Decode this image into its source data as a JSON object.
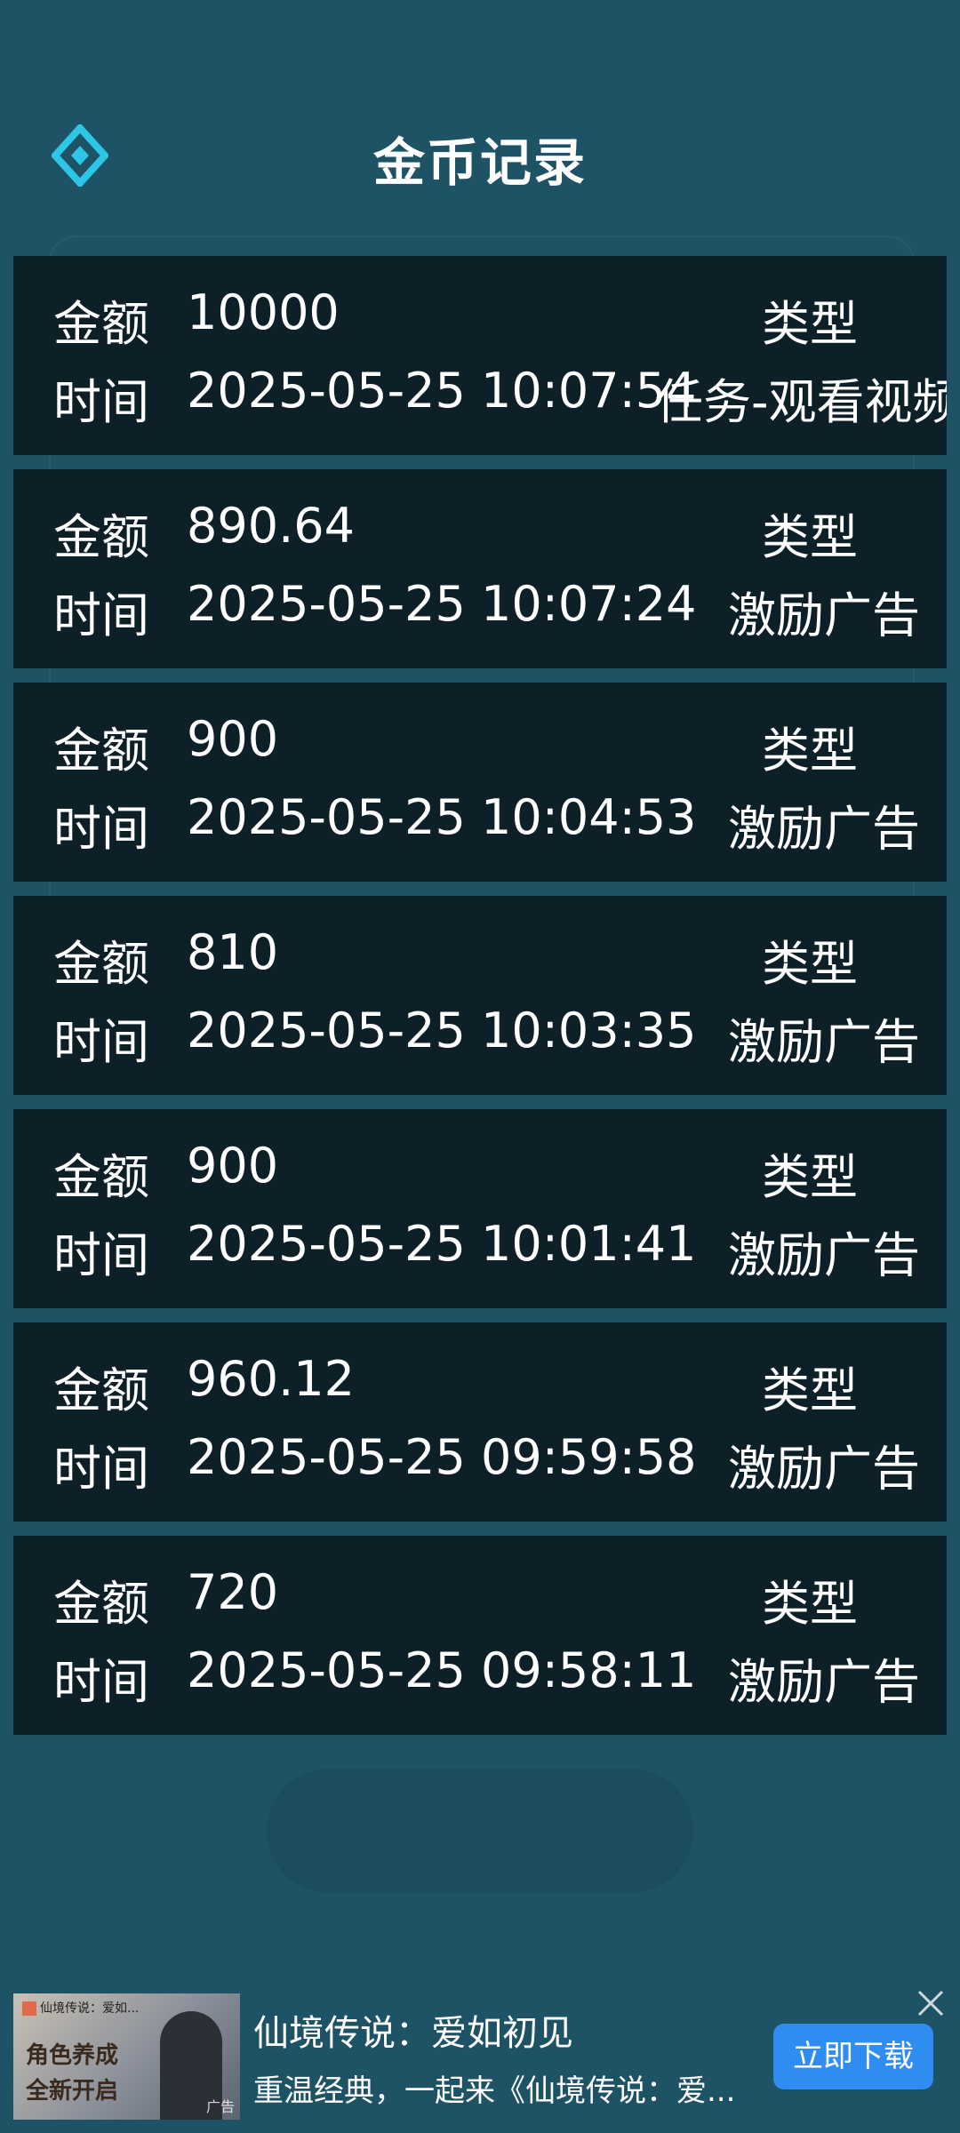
{
  "header": {
    "title": "金币记录"
  },
  "labels": {
    "amount": "金额",
    "time": "时间",
    "type": "类型"
  },
  "records": [
    {
      "amount": "10000",
      "time": "2025-05-25 10:07:54",
      "type": "任务-观看视频"
    },
    {
      "amount": "890.64",
      "time": "2025-05-25 10:07:24",
      "type": "激励广告"
    },
    {
      "amount": "900",
      "time": "2025-05-25 10:04:53",
      "type": "激励广告"
    },
    {
      "amount": "810",
      "time": "2025-05-25 10:03:35",
      "type": "激励广告"
    },
    {
      "amount": "900",
      "time": "2025-05-25 10:01:41",
      "type": "激励广告"
    },
    {
      "amount": "960.12",
      "time": "2025-05-25 09:59:58",
      "type": "激励广告"
    },
    {
      "amount": "720",
      "time": "2025-05-25 09:58:11",
      "type": "激励广告"
    }
  ],
  "ad": {
    "title": "仙境传说：爱如初见",
    "description": "重温经典，一起来《仙境传说：爱...",
    "button": "立即下载",
    "thumb_caption": "仙境传说：爱如...",
    "thumb_art_line1": "角色养成",
    "thumb_art_line2": "全新开启",
    "thumb_tag": "广告"
  },
  "colors": {
    "background": "#1e5265",
    "card": "#0d1f27",
    "accent": "#2ec6e6",
    "ad_button": "#2f8cf0"
  },
  "icons": {
    "back": "diamond-back-icon",
    "close": "close-icon"
  }
}
